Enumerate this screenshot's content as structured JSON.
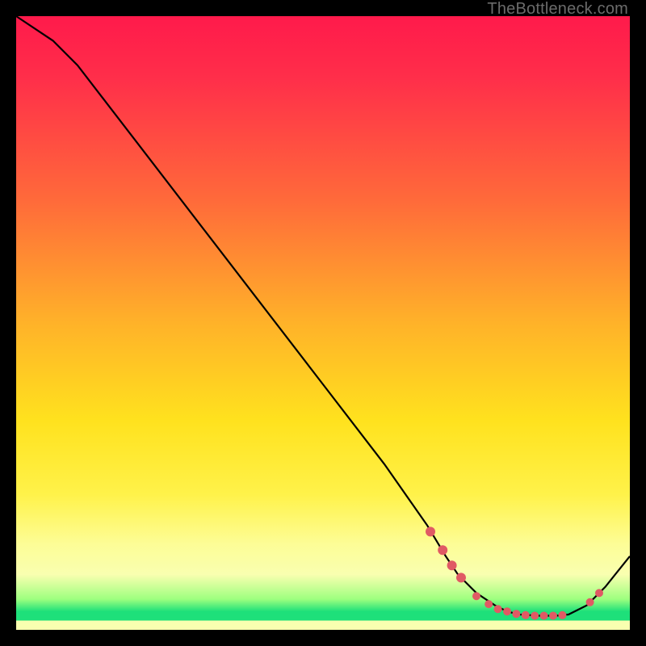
{
  "watermark": "TheBottleneck.com",
  "chart_data": {
    "type": "line",
    "title": "",
    "xlabel": "",
    "ylabel": "",
    "xlim": [
      0,
      100
    ],
    "ylim": [
      0,
      100
    ],
    "grid": false,
    "legend": false,
    "series": [
      {
        "name": "curve",
        "x": [
          0,
          6,
          10,
          20,
          30,
          40,
          50,
          60,
          67,
          70,
          72,
          75,
          78,
          80,
          82,
          85,
          88,
          90,
          93,
          96,
          100
        ],
        "values": [
          100,
          96,
          92,
          79,
          66,
          53,
          40,
          27,
          17,
          12,
          9,
          6,
          4,
          3,
          2.5,
          2.3,
          2.3,
          2.5,
          4,
          7,
          12
        ]
      }
    ],
    "markers": [
      {
        "x": 67.5,
        "y": 16,
        "r": 6
      },
      {
        "x": 69.5,
        "y": 13,
        "r": 6
      },
      {
        "x": 71.0,
        "y": 10.5,
        "r": 6
      },
      {
        "x": 72.5,
        "y": 8.5,
        "r": 6
      },
      {
        "x": 75.0,
        "y": 5.5,
        "r": 5
      },
      {
        "x": 77.0,
        "y": 4.2,
        "r": 5
      },
      {
        "x": 78.5,
        "y": 3.4,
        "r": 5
      },
      {
        "x": 80.0,
        "y": 3.0,
        "r": 5
      },
      {
        "x": 81.5,
        "y": 2.6,
        "r": 5
      },
      {
        "x": 83.0,
        "y": 2.4,
        "r": 5
      },
      {
        "x": 84.5,
        "y": 2.3,
        "r": 5
      },
      {
        "x": 86.0,
        "y": 2.3,
        "r": 5
      },
      {
        "x": 87.5,
        "y": 2.3,
        "r": 5
      },
      {
        "x": 89.0,
        "y": 2.4,
        "r": 5
      },
      {
        "x": 93.5,
        "y": 4.5,
        "r": 5
      },
      {
        "x": 95.0,
        "y": 6.0,
        "r": 5
      }
    ],
    "colors": {
      "curve": "#000000",
      "marker": "#e05a64"
    }
  }
}
